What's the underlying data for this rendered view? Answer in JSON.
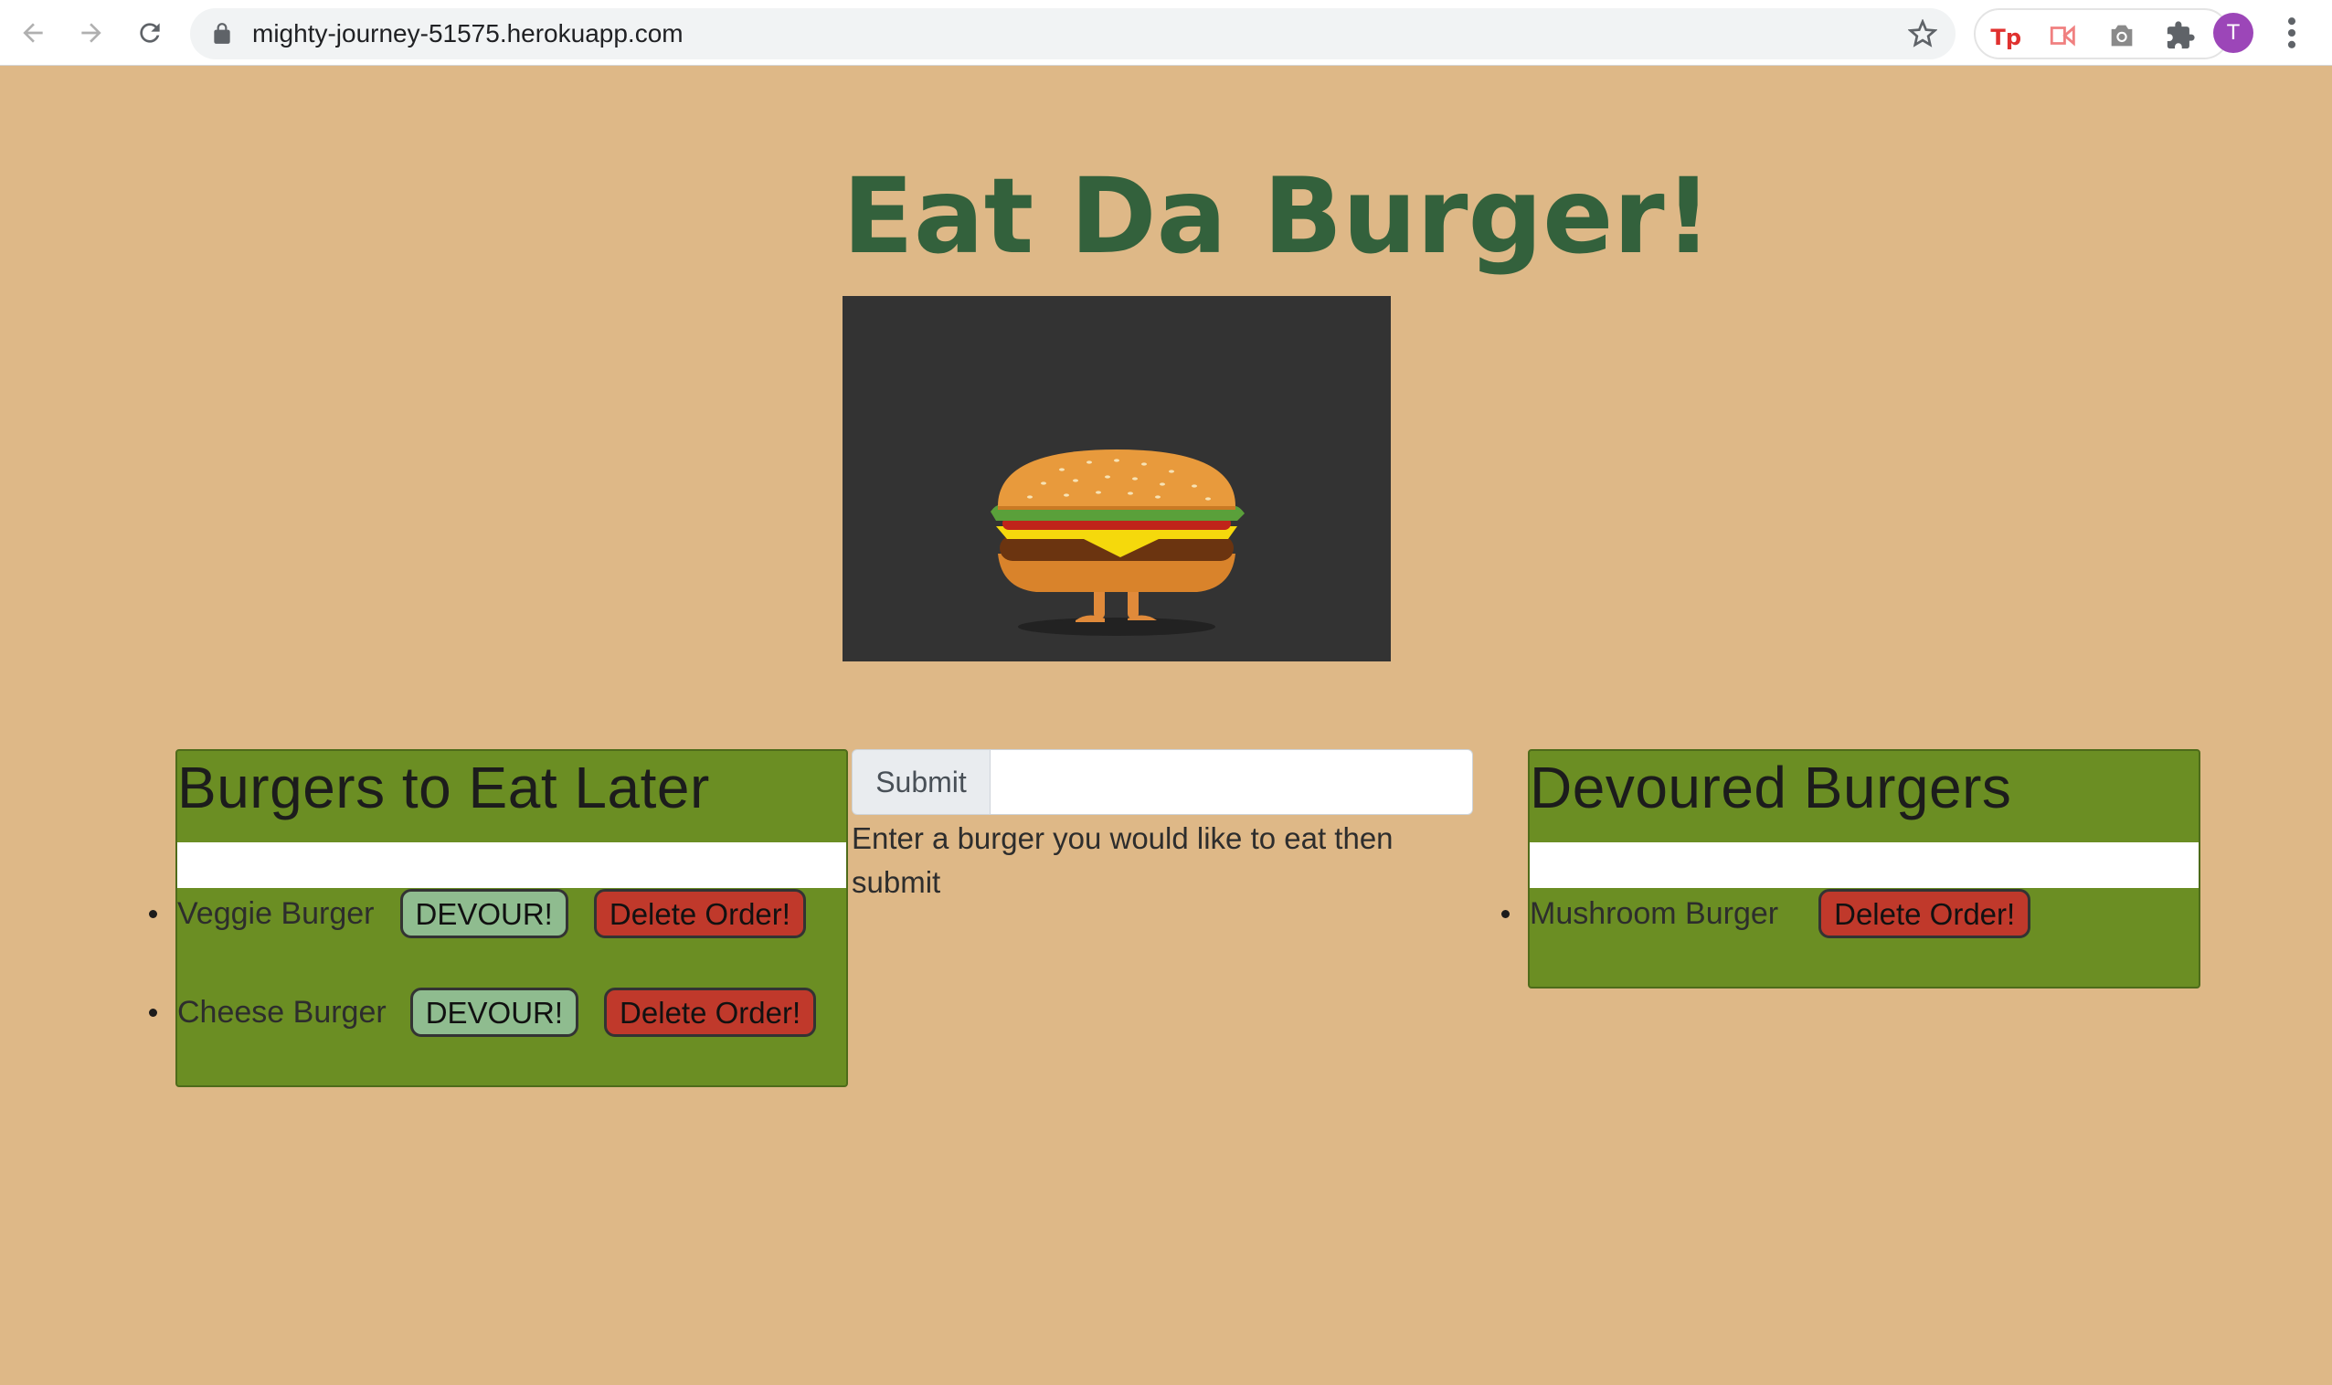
{
  "browser": {
    "url": "mighty-journey-51575.herokuapp.com",
    "avatar_letter": "T",
    "colors": {
      "avatar": "#9c46b8"
    }
  },
  "page": {
    "title": "Eat Da Burger!",
    "form": {
      "submit_label": "Submit",
      "input_value": "",
      "hint": "Enter a burger you would like to eat then submit"
    },
    "to_eat": {
      "heading": "Burgers to Eat Later",
      "items": [
        {
          "name": "Veggie Burger",
          "devour_label": "DEVOUR!",
          "delete_label": "Delete Order!"
        },
        {
          "name": "Cheese Burger",
          "devour_label": "DEVOUR!",
          "delete_label": "Delete Order!"
        }
      ]
    },
    "devoured": {
      "heading": "Devoured Burgers",
      "items": [
        {
          "name": "Mushroom Burger",
          "delete_label": "Delete Order!"
        }
      ]
    },
    "colors": {
      "background": "#deb887",
      "title": "#33613c",
      "panel": "#6b8e23",
      "devour_button": "#8fbc8f",
      "delete_button": "#c0392b"
    }
  }
}
